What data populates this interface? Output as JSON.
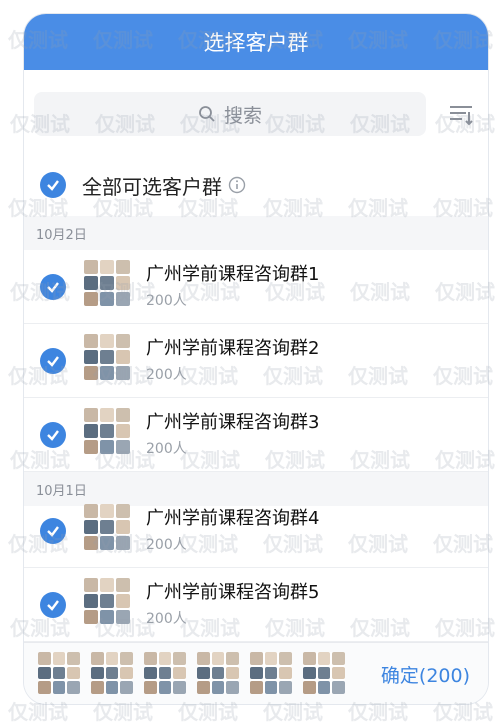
{
  "header": {
    "title": "选择客户群"
  },
  "search": {
    "placeholder": "搜索",
    "icon": "search-icon"
  },
  "filter": {
    "icon": "filter-sort-icon"
  },
  "select_all": {
    "label": "全部可选客户群",
    "checked": true,
    "info_icon": "info-icon"
  },
  "sections": [
    {
      "date": "10月2日",
      "groups": [
        {
          "name": "广州学前课程咨询群1",
          "count": "200人",
          "checked": true
        },
        {
          "name": "广州学前课程咨询群2",
          "count": "200人",
          "checked": true
        },
        {
          "name": "广州学前课程咨询群3",
          "count": "200人",
          "checked": true
        }
      ]
    },
    {
      "date": "10月1日",
      "groups": [
        {
          "name": "广州学前课程咨询群4",
          "count": "200人",
          "checked": true
        },
        {
          "name": "广州学前课程咨询群5",
          "count": "200人",
          "checked": true
        }
      ]
    }
  ],
  "footer": {
    "confirm_label": "确定(200)",
    "selected_thumb_count": 6
  },
  "watermark_text": "仅测试",
  "colors": {
    "header": "#4a8de6",
    "accent": "#3d85e0"
  }
}
